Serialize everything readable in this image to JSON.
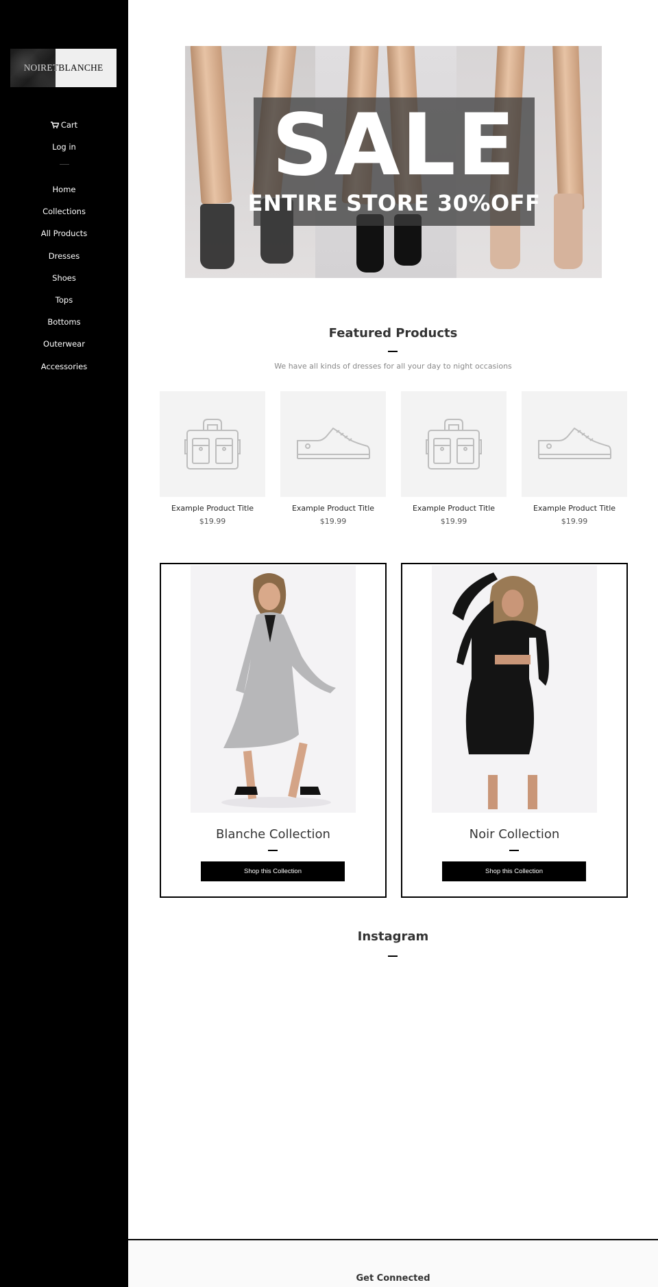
{
  "brand": {
    "name": "NOIRETBLANCHE"
  },
  "sidebar": {
    "cart_label": "Cart",
    "login_label": "Log in",
    "nav": [
      "Home",
      "Collections",
      "All Products",
      "Dresses",
      "Shoes",
      "Tops",
      "Bottoms",
      "Outerwear",
      "Accessories"
    ]
  },
  "hero": {
    "headline": "SALE",
    "subline": "ENTIRE STORE 30%OFF"
  },
  "featured": {
    "title": "Featured Products",
    "subtitle": "We have all kinds of dresses for all your day to night occasions",
    "products": [
      {
        "title": "Example Product Title",
        "price": "$19.99",
        "icon": "bag-icon"
      },
      {
        "title": "Example Product Title",
        "price": "$19.99",
        "icon": "sneaker-icon"
      },
      {
        "title": "Example Product Title",
        "price": "$19.99",
        "icon": "bag-icon"
      },
      {
        "title": "Example Product Title",
        "price": "$19.99",
        "icon": "sneaker-icon"
      }
    ]
  },
  "collections": [
    {
      "title": "Blanche Collection",
      "button": "Shop this Collection"
    },
    {
      "title": "Noir Collection",
      "button": "Shop this Collection"
    }
  ],
  "instagram": {
    "title": "Instagram"
  },
  "footer": {
    "title": "Get Connected"
  },
  "colors": {
    "sidebar_bg": "#000000",
    "button_bg": "#000000",
    "product_tile_bg": "#f3f3f3"
  }
}
